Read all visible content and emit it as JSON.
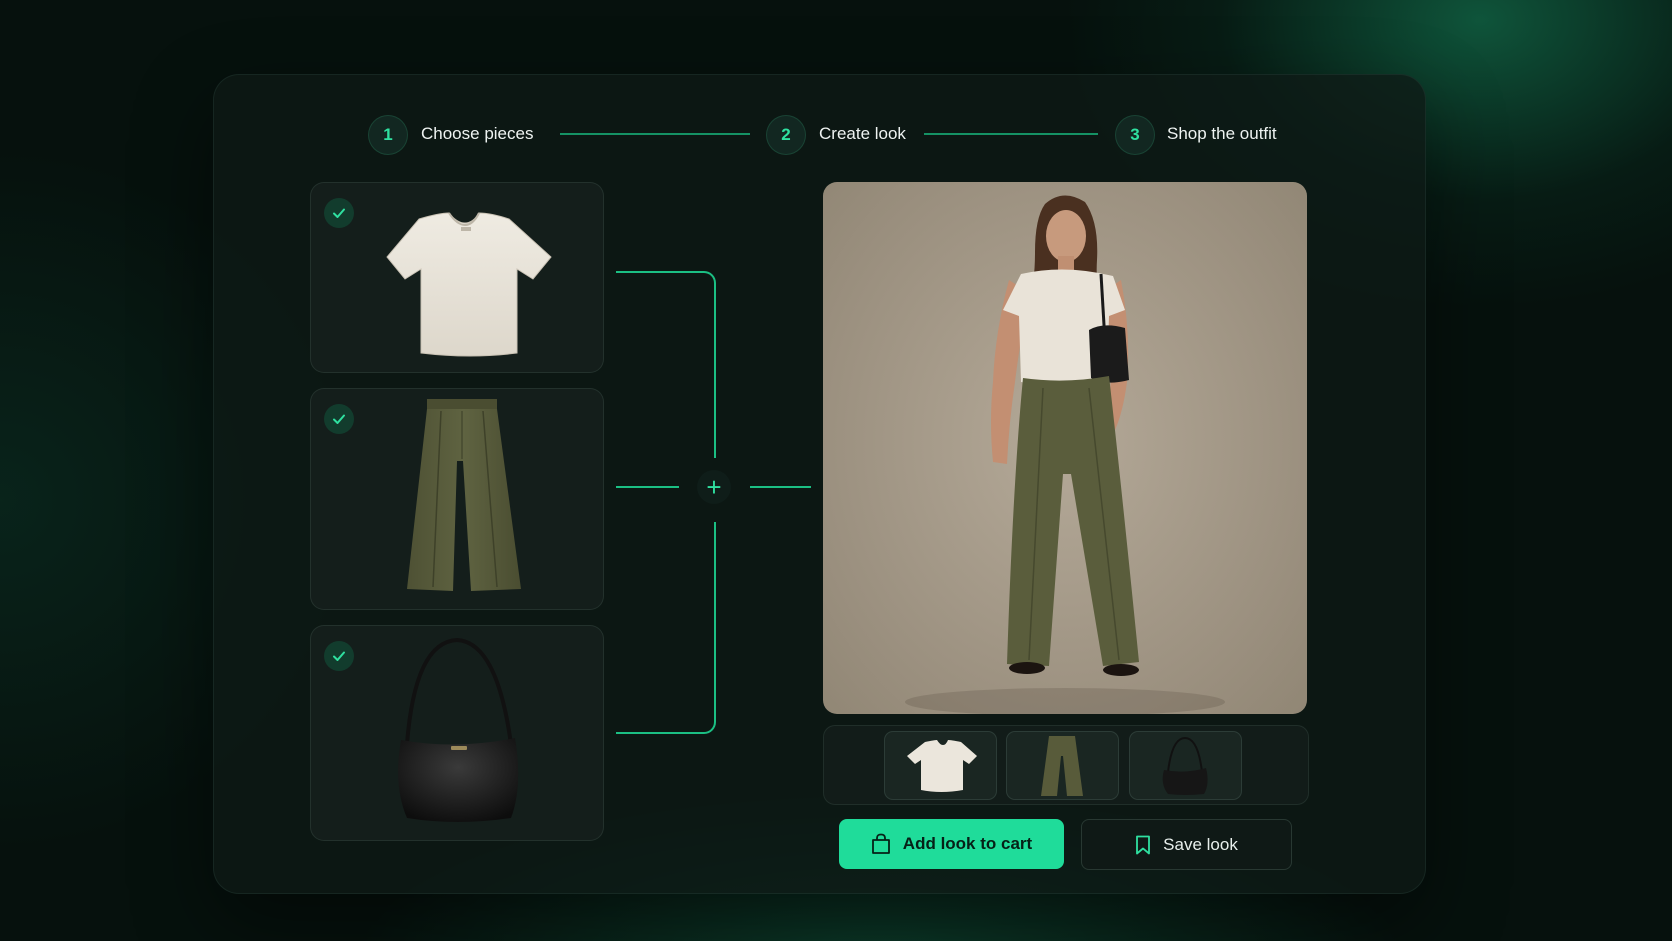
{
  "stepper": {
    "steps": [
      {
        "number": "1",
        "label": "Choose pieces"
      },
      {
        "number": "2",
        "label": "Create look"
      },
      {
        "number": "3",
        "label": "Shop the outfit"
      }
    ]
  },
  "pieces": [
    {
      "icon": "check-icon",
      "item": "t-shirt",
      "selected": true
    },
    {
      "icon": "check-icon",
      "item": "trousers",
      "selected": true
    },
    {
      "icon": "check-icon",
      "item": "shoulder-bag",
      "selected": true
    }
  ],
  "connector": {
    "icon": "plus-icon"
  },
  "actions": {
    "add_to_cart_label": "Add look to cart",
    "add_to_cart_icon": "shopping-bag-icon",
    "save_label": "Save look",
    "save_icon": "bookmark-icon"
  },
  "colors": {
    "accent": "#1fdc9a",
    "panel": "#0e1a16",
    "background": "#06110d"
  }
}
